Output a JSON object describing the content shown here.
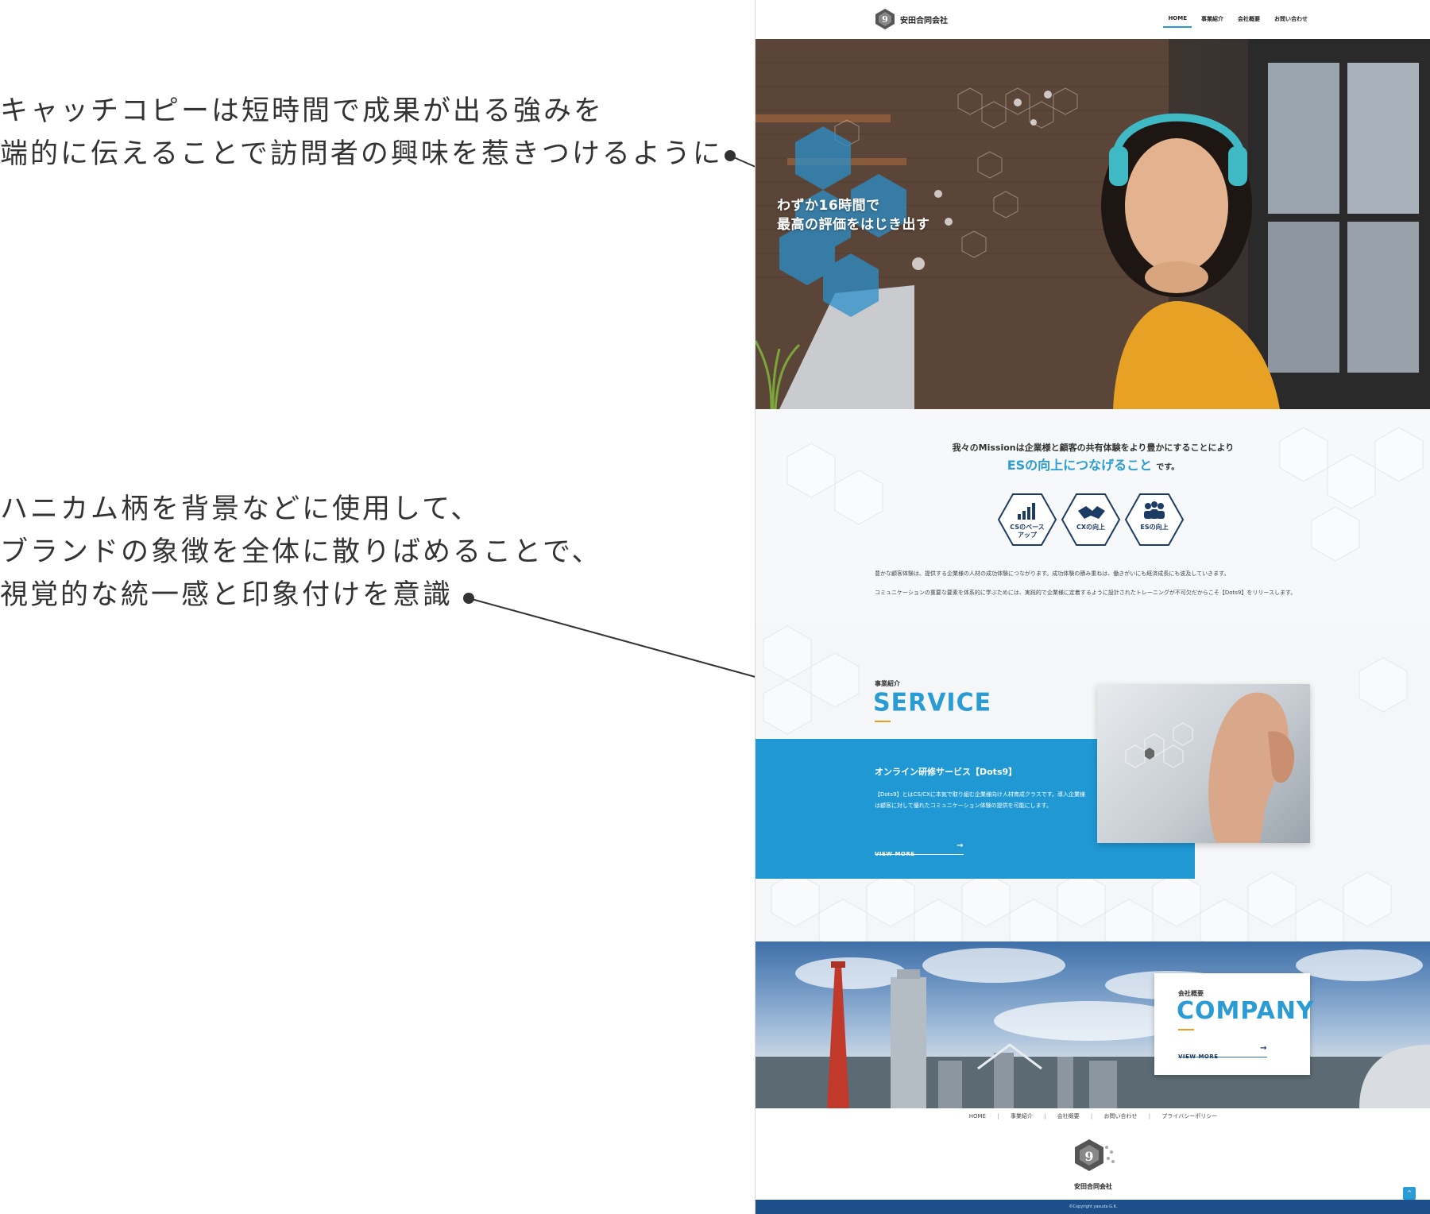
{
  "annotations": {
    "catchcopy": {
      "line1": "キャッチコピーは短時間で成果が出る強みを",
      "line2": "端的に伝えることで訪問者の興味を惹きつけるように"
    },
    "honeycomb": {
      "line1": "ハニカム柄を背景などに使用して、",
      "line2": "ブランドの象徴を全体に散りばめることで、",
      "line3": "視覚的な統一感と印象付けを意識"
    }
  },
  "header": {
    "logo_text": "安田合同会社",
    "nav": [
      "HOME",
      "事業紹介",
      "会社概要",
      "お問い合わせ"
    ],
    "active_nav": "HOME"
  },
  "hero": {
    "copy_line1": "わずか16時間で",
    "copy_line2": "最高の評価をはじき出す"
  },
  "mission": {
    "lead": "我々のMissionは企業様と顧客の共有体験をより豊かにすることにより",
    "emphasis": "ESの向上につなげること",
    "emphasis_suffix": "です。",
    "icons": [
      {
        "label_line1": "CSのベース",
        "label_line2": "アップ",
        "icon": "bar-chart-icon"
      },
      {
        "label_line1": "CXの向上",
        "label_line2": "",
        "icon": "handshake-icon"
      },
      {
        "label_line1": "ESの向上",
        "label_line2": "",
        "icon": "people-icon"
      }
    ],
    "paragraph1": "豊かな顧客体験は、提供する企業様の人材の成功体験につながります。成功体験の積み重ねは、働きがいにも経済成長にも波及していきます。",
    "paragraph2": "コミュニケーションの重要な要素を体系的に学ぶためには、実践的で企業様に定着するように設計されたトレーニングが不可欠だからこそ【Dots9】をリリースします。"
  },
  "service": {
    "small_label": "事業紹介",
    "big_label": "SERVICE",
    "title": "オンライン研修サービス【Dots9】",
    "description": "【Dots9】とはCS/CXに本気で取り組む企業様向け人材育成クラスです。導入企業様は顧客に対して優れたコミュニケーション体験の提供を可能にします。",
    "view_more": "VIEW MORE",
    "arrow": "→"
  },
  "company": {
    "small_label": "会社概要",
    "big_label": "COMPANY",
    "view_more": "VIEW MORE",
    "arrow": "→"
  },
  "footer": {
    "nav": [
      "HOME",
      "事業紹介",
      "会社概要",
      "お問い合わせ",
      "プライバシーポリシー"
    ],
    "separator": "|",
    "company_name": "安田合同会社",
    "copyright": "©Copyright yasuda G.K.",
    "to_top": "^"
  },
  "colors": {
    "accent_blue": "#2a9bd3",
    "service_blue": "#1f98d4",
    "navy": "#1d3c63",
    "footer_bar": "#1d4f8a",
    "underline_orange": "#e6a020"
  }
}
